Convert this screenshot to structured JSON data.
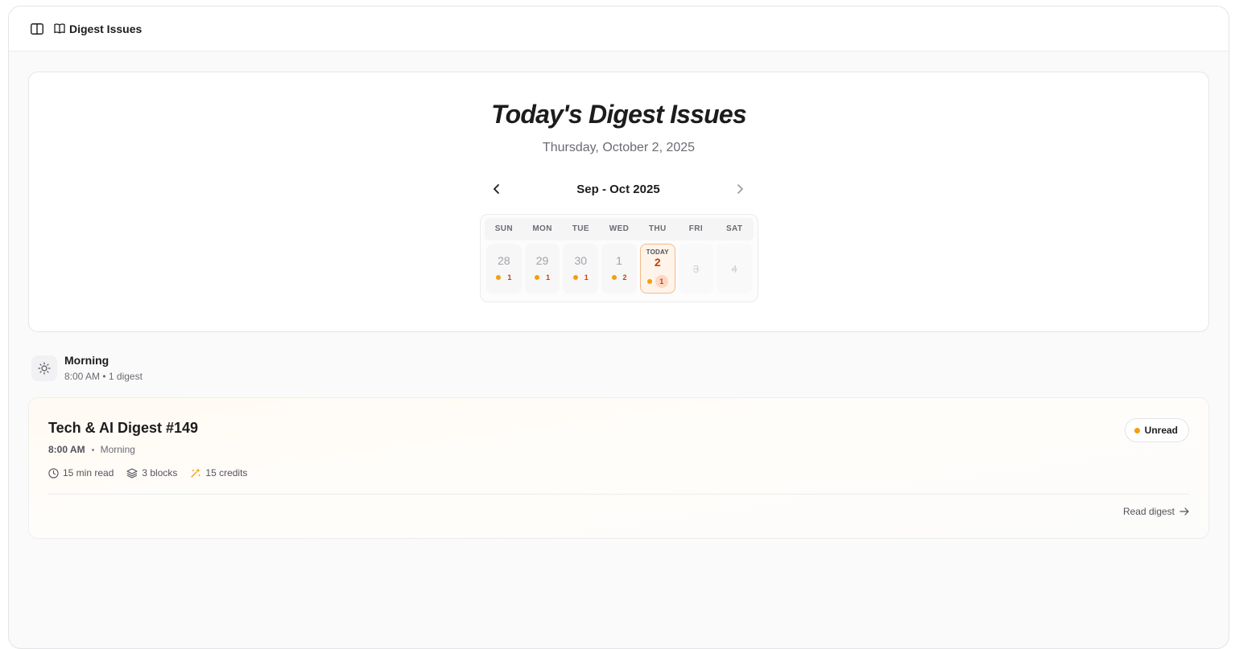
{
  "header": {
    "breadcrumb_label": "Digest Issues"
  },
  "hero": {
    "title": "Today's Digest Issues",
    "date": "Thursday, October 2, 2025",
    "month_label": "Sep - Oct 2025"
  },
  "calendar": {
    "weekdays": [
      "SUN",
      "MON",
      "TUE",
      "WED",
      "THU",
      "FRI",
      "SAT"
    ],
    "days": [
      {
        "day": "28",
        "count": "1"
      },
      {
        "day": "29",
        "count": "1"
      },
      {
        "day": "30",
        "count": "1"
      },
      {
        "day": "1",
        "count": "2"
      },
      {
        "day": "2",
        "count": "1",
        "tag": "TODAY"
      },
      {
        "day": "3"
      },
      {
        "day": "4"
      }
    ]
  },
  "section": {
    "title": "Morning",
    "subtitle": "8:00 AM • 1 digest"
  },
  "card": {
    "title": "Tech & AI Digest #149",
    "time": "8:00 AM",
    "period": "Morning",
    "read_time": "15 min read",
    "blocks": "3 blocks",
    "credits": "15 credits",
    "status": "Unread",
    "action": "Read digest"
  },
  "colors": {
    "accent": "#c2410c",
    "dot": "#f59e0b",
    "today_border": "#f4b98a",
    "today_bg": "#fff4ea"
  }
}
